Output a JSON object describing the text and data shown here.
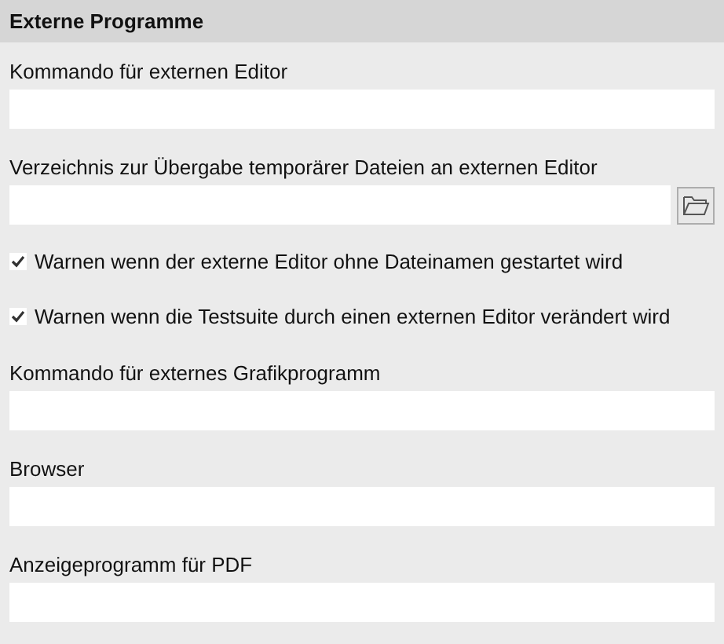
{
  "section": {
    "title": "Externe Programme"
  },
  "items": [
    {
      "kind": "field",
      "label": "Kommando für externen Editor"
    },
    {
      "kind": "browse",
      "label": "Verzeichnis zur Übergabe temporärer Dateien an externen Editor"
    },
    {
      "kind": "checkbox",
      "label": "Warnen wenn der externe Editor ohne Dateinamen gestartet wird",
      "checked": true
    },
    {
      "kind": "checkbox",
      "label": "Warnen wenn die Testsuite durch einen externen Editor verändert wird",
      "checked": true
    },
    {
      "kind": "field",
      "label": "Kommando für externes Grafikprogramm"
    },
    {
      "kind": "field",
      "label": "Browser"
    },
    {
      "kind": "field",
      "label": "Anzeigeprogramm für PDF"
    }
  ]
}
